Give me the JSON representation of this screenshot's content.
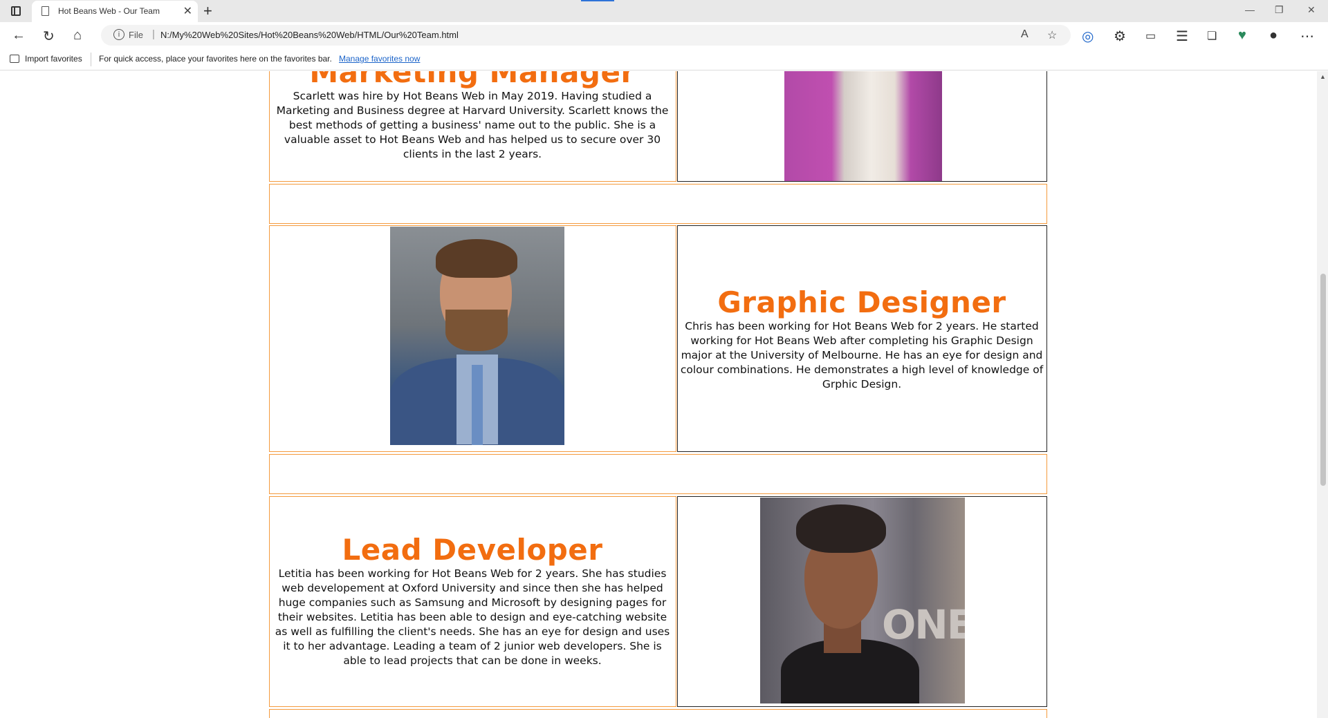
{
  "browser": {
    "tab_title": "Hot Beans Web - Our Team",
    "new_tab_symbol": "+",
    "close_symbol": "✕",
    "address_scheme": "File",
    "address_url": "N:/My%20Web%20Sites/Hot%20Beans%20Web/HTML/Our%20Team.html",
    "favorites_import": "Import favorites",
    "favorites_message": "For quick access, place your favorites here on the favorites bar.",
    "favorites_manage": "Manage favorites now"
  },
  "team": [
    {
      "role": "Marketing Manager",
      "bio": "Scarlett was hire by Hot Beans Web in May 2019. Having studied a Marketing and Business degree at Harvard University. Scarlett knows the best methods of getting a business' name out to the public. She is a valuable asset to Hot Beans Web and has helped us to secure over 30 clients in the last 2 years."
    },
    {
      "role": "Graphic Designer",
      "bio": "Chris has been working for Hot Beans Web for 2 years. He started working for Hot Beans Web after completing his Graphic Design major at the University of Melbourne. He has an eye for design and colour combinations. He demonstrates a high level of knowledge of Grphic Design."
    },
    {
      "role": "Lead Developer",
      "bio": "Letitia has been working for Hot Beans Web for 2 years. She has studies web developement at Oxford University and since then she has helped huge companies such as Samsung and Microsoft by designing pages for their websites. Letitia has been able to design and eye-catching website as well as fulfilling the client's needs. She has an eye for design and uses it to her advantage. Leading a team of 2 junior web developers. She is able to lead projects that can be done in weeks."
    }
  ]
}
